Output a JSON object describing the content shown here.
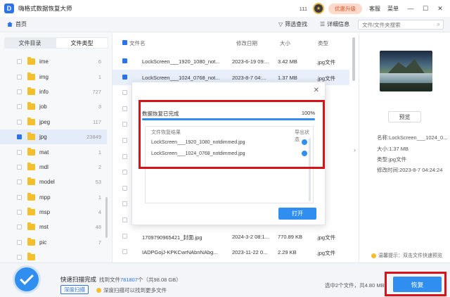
{
  "app": {
    "title": "嗨格式数据恢复大师",
    "logo_letter": "D",
    "count": "111",
    "upgrade_label": "优惠升级",
    "service_label": "客服",
    "menu_label": "菜单",
    "minimize": "—",
    "maximize": "☐",
    "close": "✕"
  },
  "toolbar": {
    "home_label": "首页",
    "filter_label": "筛选查找",
    "detail_label": "详细信息",
    "search_placeholder": "文件/文件夹搜索"
  },
  "sidebar": {
    "tabs": [
      "文件目录",
      "文件类型"
    ],
    "active_tab": 1,
    "folders": [
      {
        "name": "ime",
        "count": "6"
      },
      {
        "name": "img",
        "count": "1"
      },
      {
        "name": "info",
        "count": "727"
      },
      {
        "name": "job",
        "count": "3"
      },
      {
        "name": "jpeg",
        "count": "117"
      },
      {
        "name": "jpg",
        "count": "23849"
      },
      {
        "name": "mat",
        "count": "1"
      },
      {
        "name": "mdl",
        "count": "2"
      },
      {
        "name": "model",
        "count": "53"
      },
      {
        "name": "mpp",
        "count": "1"
      },
      {
        "name": "msp",
        "count": "4"
      },
      {
        "name": "mst",
        "count": "48"
      },
      {
        "name": "pic",
        "count": "7"
      },
      {
        "name": "",
        "count": ""
      }
    ],
    "selected_index": 5
  },
  "file_list": {
    "headers": {
      "name": "文件名",
      "modified": "修改日期",
      "size": "大小",
      "type": "类型"
    },
    "rows": [
      {
        "name": "LockScreen___1920_1080_not...",
        "modified": "2023-6-19 09:...",
        "size": "3.42 MB",
        "type": ".jpg文件",
        "checked": true,
        "highlight": false
      },
      {
        "name": "LockScreen___1024_0768_not...",
        "modified": "2023-8-7 04:...",
        "size": "1.37 MB",
        "type": ".jpg文件",
        "checked": true,
        "highlight": true
      },
      {
        "name": "",
        "modified": "",
        "size": "",
        "type": "",
        "checked": false,
        "highlight": false
      },
      {
        "name": "",
        "modified": "",
        "size": "",
        "type": "",
        "checked": false,
        "highlight": false
      },
      {
        "name": "",
        "modified": "",
        "size": "",
        "type": "",
        "checked": false,
        "highlight": false
      },
      {
        "name": "",
        "modified": "",
        "size": "",
        "type": "",
        "checked": false,
        "highlight": false
      },
      {
        "name": "",
        "modified": "",
        "size": "",
        "type": "",
        "checked": false,
        "highlight": false
      },
      {
        "name": "",
        "modified": "",
        "size": "",
        "type": "",
        "checked": false,
        "highlight": false
      },
      {
        "name": "",
        "modified": "",
        "size": "",
        "type": "",
        "checked": false,
        "highlight": false
      },
      {
        "name": "",
        "modified": "",
        "size": "",
        "type": "",
        "checked": false,
        "highlight": false
      },
      {
        "name": "",
        "modified": "",
        "size": "",
        "type": "",
        "checked": false,
        "highlight": false
      },
      {
        "name": "1709790965421_封面.jpg",
        "modified": "2024-3-2 08:1...",
        "size": "770.89 KB",
        "type": ".jpg文件",
        "checked": false,
        "highlight": false
      },
      {
        "name": "IADPGojJ-KPKCwrNAbnNAbg...",
        "modified": "2023-11-22 0...",
        "size": "2.29 KB",
        "type": ".jpg文件",
        "checked": false,
        "highlight": false
      }
    ]
  },
  "preview": {
    "preview_btn": "预览",
    "name_line": "名称:LockScreen___1024_0...",
    "size_line": "大小:1.37 MB",
    "type_line": "类型:jpg文件",
    "modified_line": "修改时间:2023-8-7 04:24:24",
    "hint": "温馨提示：双击文件快速预览"
  },
  "dialog": {
    "status": "数据恢复已完成",
    "percent_text": "100%",
    "progress": 1.0,
    "col_result": "文件恢复结果",
    "col_export": "导出状态",
    "results": [
      {
        "name": "LockScreen___1920_1080_notdimmed.jpg"
      },
      {
        "name": "LockScreen___1024_0768_notdimmed.jpg"
      }
    ],
    "open_label": "打开",
    "close_icon": "✕"
  },
  "bottom": {
    "scan_title": "快速扫描完成",
    "found_prefix": "找到文件",
    "found_count": "781807",
    "found_suffix": "个（共98.08 GB）",
    "deep_scan": "深度扫描",
    "deep_hint": "深度扫描可以找到更多文件",
    "selection_info": "选中2个文件，共4.80 MB",
    "recover_label": "恢复"
  },
  "colors": {
    "accent": "#2f8ef0",
    "highlight_frame": "#d9121a",
    "folder": "#f3bf2f"
  }
}
